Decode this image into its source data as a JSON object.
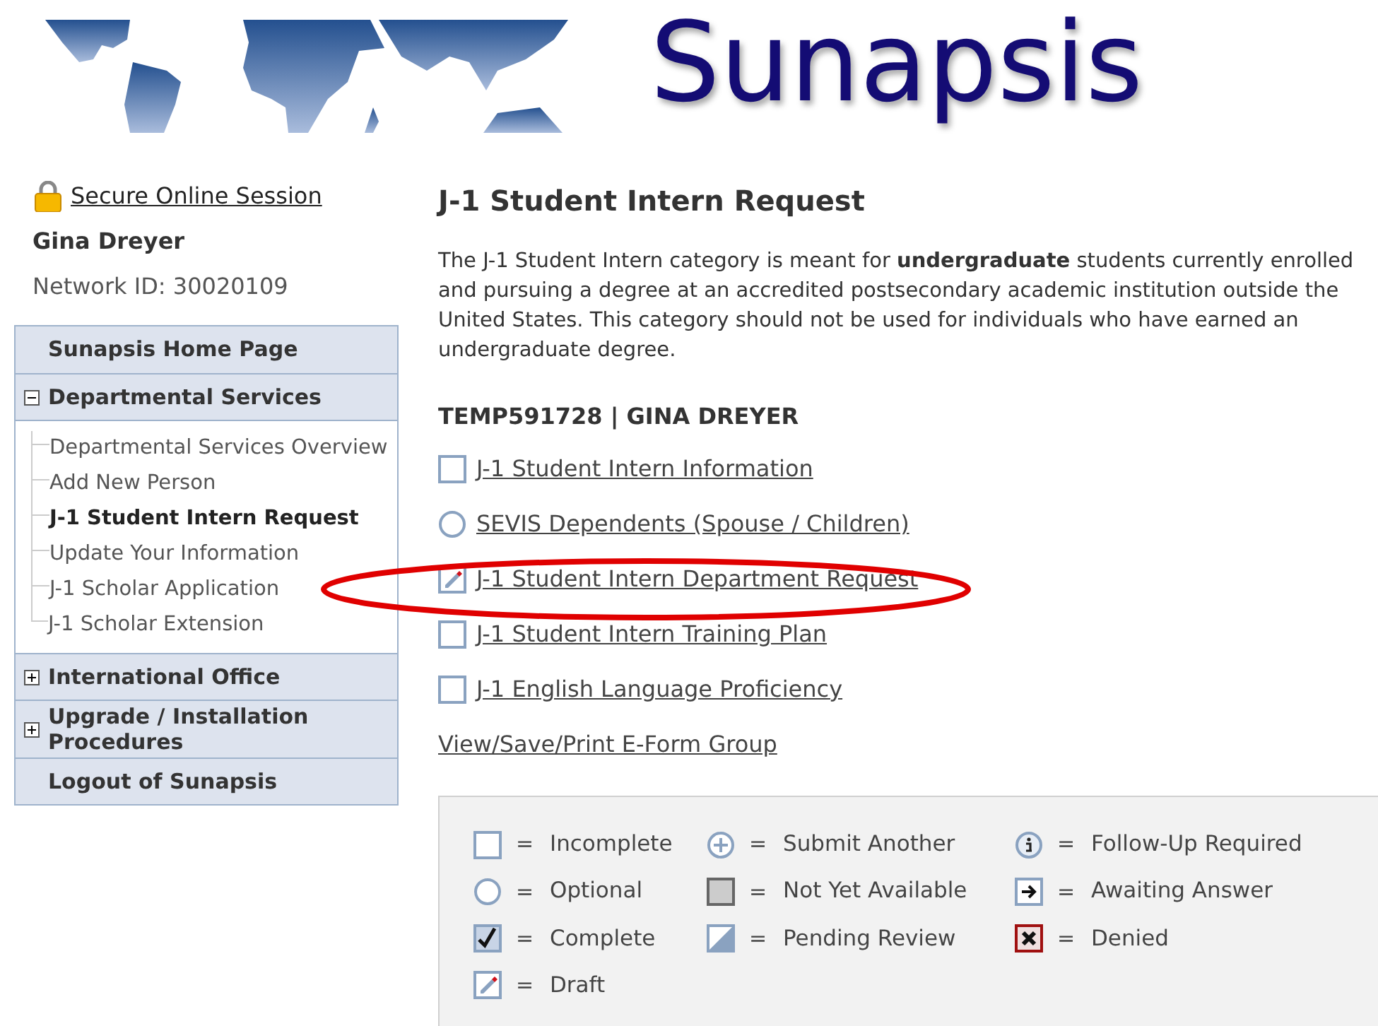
{
  "header": {
    "title": "Sunapsis"
  },
  "session": {
    "link": "Secure Online Session",
    "user_name": "Gina Dreyer",
    "network_id": "Network ID: 30020109"
  },
  "nav": [
    {
      "label": "Sunapsis Home Page",
      "kind": "link"
    },
    {
      "label": "Departmental Services",
      "kind": "group",
      "expanded": true,
      "children": [
        {
          "label": "Departmental Services Overview",
          "selected": false
        },
        {
          "label": "Add New Person",
          "selected": false
        },
        {
          "label": "J-1 Student Intern Request",
          "selected": true
        },
        {
          "label": "Update Your Information",
          "selected": false
        },
        {
          "label": "J-1 Scholar Application",
          "selected": false
        },
        {
          "label": "J-1 Scholar Extension",
          "selected": false
        }
      ]
    },
    {
      "label": "International Office",
      "kind": "group",
      "expanded": false
    },
    {
      "label": "Upgrade / Installation Procedures",
      "kind": "group",
      "expanded": false
    },
    {
      "label": "Logout of Sunapsis",
      "kind": "link"
    }
  ],
  "main": {
    "title": "J-1 Student Intern Request",
    "description": "The J-1 Student Intern category is meant for **undergraduate** students currently enrolled and pursuing a degree at an accredited postsecondary academic institution outside the United States. This category should not be used for individuals who have earned an undergraduate degree.",
    "record": "TEMP591728 | GINA DREYER",
    "forms": [
      {
        "label": "J-1 Student Intern Information",
        "kind": "incomplete"
      },
      {
        "label": "SEVIS Dependents (Spouse / Children)",
        "kind": "optional"
      },
      {
        "label": "J-1 Student Intern Department Request",
        "kind": "draft"
      },
      {
        "label": "J-1 Student Intern Training Plan",
        "kind": "incomplete"
      },
      {
        "label": "J-1 English Language Proficiency",
        "kind": "incomplete"
      }
    ],
    "group_link": "View/Save/Print E-Form Group"
  },
  "legend": [
    {
      "kind": "incomplete",
      "sign": "=",
      "label": "Incomplete"
    },
    {
      "kind": "submit_another",
      "sign": "=",
      "label": "Submit Another"
    },
    {
      "kind": "follow_up",
      "sign": "=",
      "label": "Follow-Up Required"
    },
    {
      "kind": "optional",
      "sign": "=",
      "label": "Optional"
    },
    {
      "kind": "not_available",
      "sign": "=",
      "label": "Not Yet Available"
    },
    {
      "kind": "awaiting",
      "sign": "=",
      "label": "Awaiting Answer"
    },
    {
      "kind": "complete",
      "sign": "=",
      "label": "Complete"
    },
    {
      "kind": "pending",
      "sign": "=",
      "label": "Pending Review"
    },
    {
      "kind": "denied",
      "sign": "=",
      "label": "Denied"
    },
    {
      "kind": "draft",
      "sign": "=",
      "label": "Draft"
    }
  ]
}
